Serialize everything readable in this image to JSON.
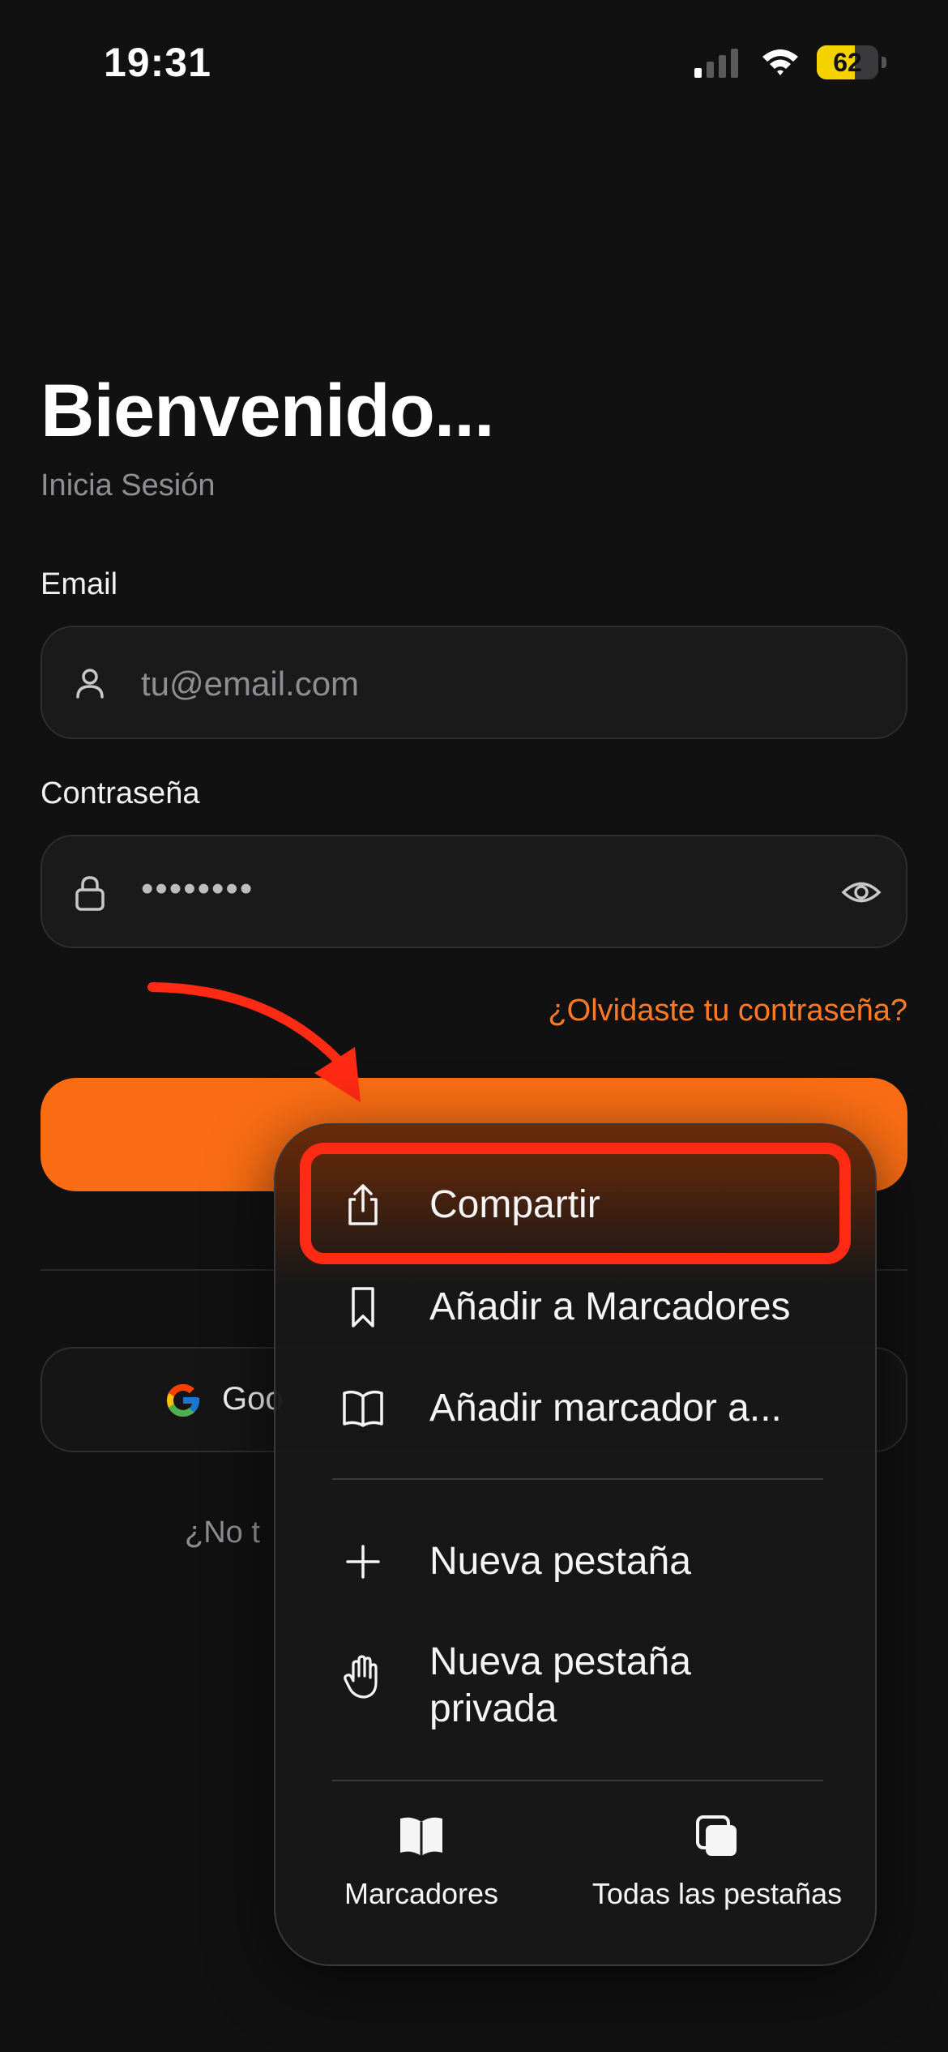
{
  "status_bar": {
    "time": "19:31",
    "battery_level": "62",
    "battery_fraction": 0.62,
    "battery_color": "#f5d300"
  },
  "login": {
    "title": "Bienvenido...",
    "subtitle": "Inicia Sesión",
    "email_label": "Email",
    "email_placeholder": "tu@email.com",
    "password_label": "Contraseña",
    "password_value": "••••••••",
    "forgot_password": "¿Olvidaste tu contraseña?",
    "google_button": "Goo",
    "signup_text": "¿No t",
    "accent_color": "#fa6d14"
  },
  "menu": {
    "items": [
      {
        "label": "Compartir",
        "icon": "share-icon"
      },
      {
        "label": "Añadir a Marcadores",
        "icon": "bookmark-icon"
      },
      {
        "label": "Añadir marcador a...",
        "icon": "book-open-icon"
      },
      {
        "label": "Nueva pestaña",
        "icon": "plus-icon"
      },
      {
        "label": "Nueva pestaña privada",
        "icon": "hand-icon"
      }
    ],
    "bottom": [
      {
        "label": "Marcadores",
        "icon": "book-icon"
      },
      {
        "label": "Todas las pestañas",
        "icon": "tabs-icon"
      }
    ],
    "highlight_color": "#ff2a14"
  }
}
